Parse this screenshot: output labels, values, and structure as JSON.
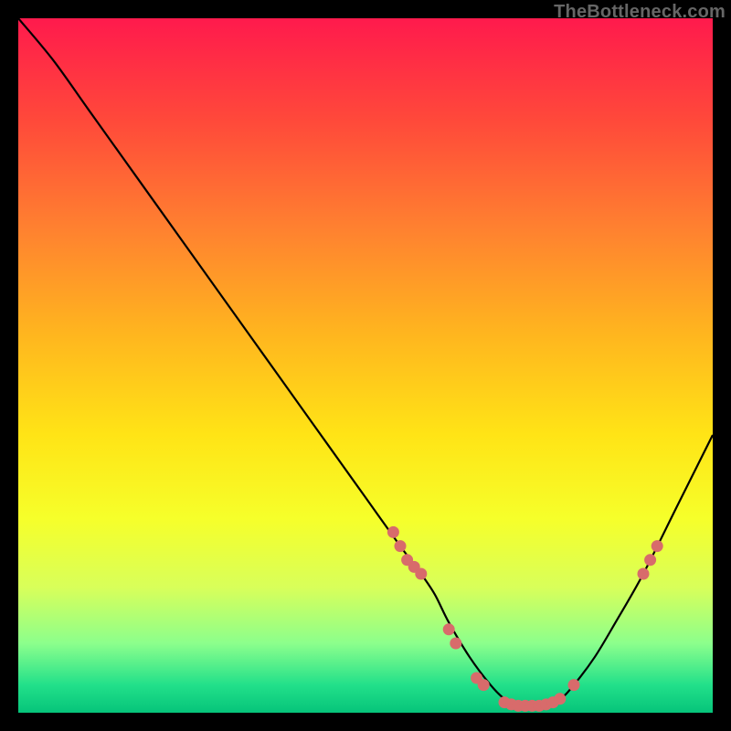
{
  "watermark": "TheBottleneck.com",
  "chart_data": {
    "type": "line",
    "title": "",
    "xlabel": "",
    "ylabel": "",
    "xlim": [
      0,
      100
    ],
    "ylim": [
      0,
      100
    ],
    "curve": {
      "name": "bottleneck-curve",
      "x": [
        0,
        5,
        10,
        15,
        20,
        25,
        30,
        35,
        40,
        45,
        50,
        55,
        58,
        60,
        62,
        65,
        68,
        70,
        72,
        75,
        78,
        80,
        83,
        86,
        90,
        95,
        100
      ],
      "y": [
        100,
        94,
        87,
        80,
        73,
        66,
        59,
        52,
        45,
        38,
        31,
        24,
        20,
        17,
        13,
        8,
        4,
        2,
        1,
        1,
        2,
        4,
        8,
        13,
        20,
        30,
        40
      ]
    },
    "markers": {
      "name": "sample-points",
      "color": "#d86b6b",
      "points": [
        {
          "x": 54,
          "y": 26
        },
        {
          "x": 55,
          "y": 24
        },
        {
          "x": 56,
          "y": 22
        },
        {
          "x": 57,
          "y": 21
        },
        {
          "x": 58,
          "y": 20
        },
        {
          "x": 62,
          "y": 12
        },
        {
          "x": 63,
          "y": 10
        },
        {
          "x": 66,
          "y": 5
        },
        {
          "x": 67,
          "y": 4
        },
        {
          "x": 70,
          "y": 1.5
        },
        {
          "x": 71,
          "y": 1.2
        },
        {
          "x": 72,
          "y": 1
        },
        {
          "x": 73,
          "y": 1
        },
        {
          "x": 74,
          "y": 1
        },
        {
          "x": 75,
          "y": 1
        },
        {
          "x": 76,
          "y": 1.2
        },
        {
          "x": 77,
          "y": 1.5
        },
        {
          "x": 78,
          "y": 2
        },
        {
          "x": 80,
          "y": 4
        },
        {
          "x": 90,
          "y": 20
        },
        {
          "x": 91,
          "y": 22
        },
        {
          "x": 92,
          "y": 24
        }
      ]
    },
    "gradient_stops": [
      {
        "offset": 0.0,
        "color": "#ff1a4d"
      },
      {
        "offset": 0.05,
        "color": "#ff2a46"
      },
      {
        "offset": 0.15,
        "color": "#ff4a3a"
      },
      {
        "offset": 0.3,
        "color": "#ff8030"
      },
      {
        "offset": 0.45,
        "color": "#ffb41f"
      },
      {
        "offset": 0.6,
        "color": "#ffe416"
      },
      {
        "offset": 0.72,
        "color": "#f6ff2a"
      },
      {
        "offset": 0.82,
        "color": "#d8ff5a"
      },
      {
        "offset": 0.9,
        "color": "#8cff8c"
      },
      {
        "offset": 0.96,
        "color": "#22e08a"
      },
      {
        "offset": 1.0,
        "color": "#06c47a"
      }
    ]
  }
}
